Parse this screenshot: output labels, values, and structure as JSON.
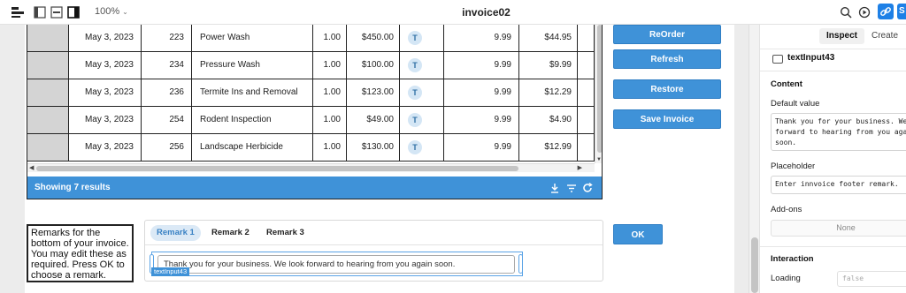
{
  "app": {
    "title": "invoice02",
    "zoom": "100%"
  },
  "table": {
    "rows": [
      {
        "date": "May 3, 2023",
        "id": "223",
        "desc": "Power Wash",
        "qty": "1.00",
        "price": "$450.00",
        "tax": "T",
        "rate": "9.99",
        "total": "$44.95"
      },
      {
        "date": "May 3, 2023",
        "id": "234",
        "desc": "Pressure Wash",
        "qty": "1.00",
        "price": "$100.00",
        "tax": "T",
        "rate": "9.99",
        "total": "$9.99"
      },
      {
        "date": "May 3, 2023",
        "id": "236",
        "desc": "Termite Ins and Removal",
        "qty": "1.00",
        "price": "$123.00",
        "tax": "T",
        "rate": "9.99",
        "total": "$12.29"
      },
      {
        "date": "May 3, 2023",
        "id": "254",
        "desc": "Rodent Inspection",
        "qty": "1.00",
        "price": "$49.00",
        "tax": "T",
        "rate": "9.99",
        "total": "$4.90"
      },
      {
        "date": "May 3, 2023",
        "id": "256",
        "desc": "Landscape Herbicide",
        "qty": "1.00",
        "price": "$130.00",
        "tax": "T",
        "rate": "9.99",
        "total": "$12.99"
      }
    ],
    "footer_text": "Showing 7 results"
  },
  "buttons": {
    "reorder": "ReOrder",
    "refresh": "Refresh",
    "restore": "Restore",
    "save_invoice": "Save Invoice",
    "ok": "OK"
  },
  "remarks": {
    "instructions": "Remarks for the bottom of your invoice. You may edit these as required. Press OK to choose a remark.",
    "tabs": [
      "Remark 1",
      "Remark 2",
      "Remark 3"
    ],
    "active_tab": 0,
    "input_value": "Thank you for your business. We look forward to hearing from you again soon.",
    "selected_component_label": "textInput43"
  },
  "inspector": {
    "tabs": [
      "Inspect",
      "Create"
    ],
    "active_tab": "Inspect",
    "component_name": "textInput43",
    "section_content": "Content",
    "default_value_label": "Default value",
    "default_value": "Thank you for your business. We look\nforward to hearing from you again\nsoon.",
    "placeholder_label": "Placeholder",
    "placeholder_value": "Enter innvoice footer remark.",
    "addons_label": "Add-ons",
    "addons_value": "None",
    "section_interaction": "Interaction",
    "loading_label": "Loading",
    "loading_value": "false"
  },
  "colors": {
    "accent": "#3f92d8",
    "selection": "#5aa3e6"
  }
}
